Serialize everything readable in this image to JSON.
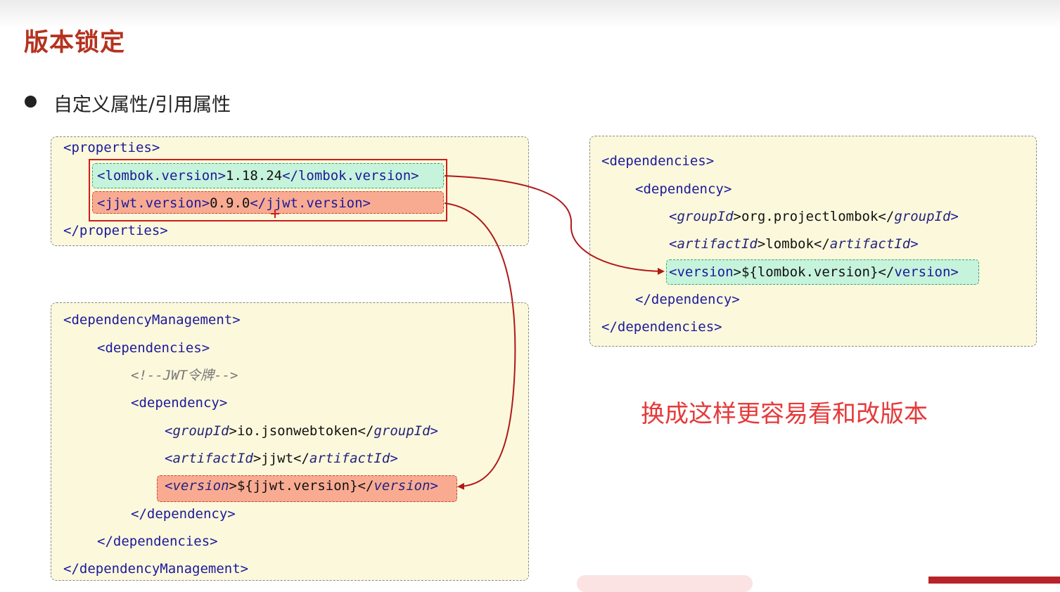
{
  "title": "版本锁定",
  "bullet": "自定义属性/引用属性",
  "note": "换成这样更容易看和改版本",
  "properties_box": {
    "open": {
      "lt": "<",
      "name": "properties",
      "gt": ">"
    },
    "lombok": {
      "open": "<lombok.version>",
      "value": "1.18.24",
      "close": "</lombok.version>"
    },
    "jjwt": {
      "open": "<jjwt.version>",
      "value": "0.9.0",
      "close": "</jjwt.version>"
    },
    "close": {
      "lt": "</",
      "name": "properties",
      "gt": ">"
    }
  },
  "dm_box": {
    "l1": {
      "lt": "<",
      "name": "dependencyManagement",
      "gt": ">"
    },
    "l2": {
      "lt": "<",
      "name": "dependencies",
      "gt": ">"
    },
    "l3": "<!--JWT令牌-->",
    "l4": {
      "lt": "<",
      "name": "dependency",
      "gt": ">"
    },
    "l5": {
      "a": "<",
      "b": "groupId",
      "c": ">io.jsonwebtoken</",
      "d": "groupId",
      "e": ">"
    },
    "l6": {
      "a": "<",
      "b": "artifactId",
      "c": ">jjwt</",
      "d": "artifactId",
      "e": ">"
    },
    "l7": {
      "a": "<",
      "b": "version",
      "c": ">${jjwt.version}</",
      "d": "version",
      "e": ">"
    },
    "l8": {
      "lt": "</",
      "name": "dependency",
      "gt": ">"
    },
    "l9": {
      "lt": "</",
      "name": "dependencies",
      "gt": ">"
    },
    "l10": {
      "lt": "</",
      "name": "dependencyManagement",
      "gt": ">"
    }
  },
  "deps_box": {
    "l1": {
      "lt": "<",
      "name": "dependencies",
      "gt": ">"
    },
    "l2": {
      "lt": "<",
      "name": "dependency",
      "gt": ">"
    },
    "l3": {
      "a": "<",
      "b": "groupId",
      "c": ">org.projectlombok</",
      "d": "groupId",
      "e": ">"
    },
    "l4": {
      "a": "<",
      "b": "artifactId",
      "c": ">lombok</",
      "d": "artifactId",
      "e": ">"
    },
    "l5": {
      "a": "<",
      "b": "version",
      "c": ">${lombok.version}</",
      "d": "version",
      "e": ">"
    },
    "l6": {
      "lt": "</",
      "name": "dependency",
      "gt": ">"
    },
    "l7": {
      "lt": "</",
      "name": "dependencies",
      "gt": ">"
    }
  },
  "colors": {
    "title": "#b5321f",
    "note": "#e53a3a",
    "code_bg": "#fcf8dc",
    "highlight_green": "#c6f3db",
    "highlight_red": "#f9ab92",
    "arrow": "#b01818"
  }
}
